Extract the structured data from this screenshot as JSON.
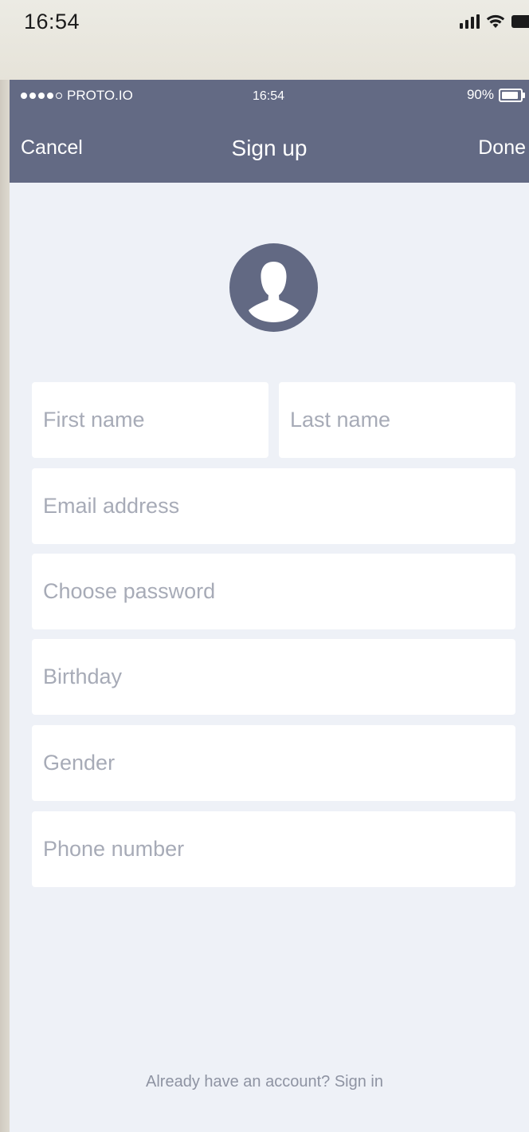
{
  "device_status": {
    "time": "16:54",
    "icons": [
      "signal-icon",
      "wifi-icon",
      "battery-icon"
    ]
  },
  "app_status": {
    "carrier": "PROTO.IO",
    "signal_dots_filled": 4,
    "signal_dots_total": 5,
    "time": "16:54",
    "battery_text": "90%",
    "battery_level": 0.9
  },
  "navbar": {
    "cancel_label": "Cancel",
    "title": "Sign up",
    "done_label": "Done"
  },
  "form": {
    "first_name_placeholder": "First name",
    "last_name_placeholder": "Last name",
    "email_placeholder": "Email address",
    "password_placeholder": "Choose password",
    "birthday_placeholder": "Birthday",
    "gender_placeholder": "Gender",
    "phone_placeholder": "Phone number"
  },
  "footer": {
    "signin_text": "Already have an account? Sign in"
  },
  "colors": {
    "navbar": "#636a84",
    "background": "#eef1f7",
    "field": "#ffffff",
    "placeholder": "#a7abb7",
    "footer_text": "#8e93a2"
  }
}
